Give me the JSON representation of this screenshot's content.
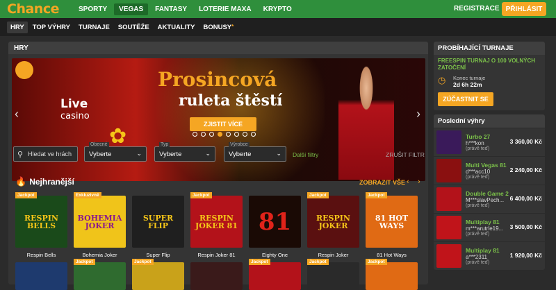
{
  "header": {
    "logo": "Chance",
    "nav": [
      "SPORTY",
      "VEGAS",
      "FANTASY",
      "LOTERIE MAXA",
      "KRYPTO"
    ],
    "active_nav": "VEGAS",
    "register": "REGISTRACE",
    "login": "PŘIHLÁSIT"
  },
  "subnav": {
    "items": [
      "HRY",
      "TOP VÝHRY",
      "TURNAJE",
      "SOUTĚŽE",
      "AKTUALITY",
      "BONUSY"
    ],
    "active": "HRY",
    "bonus_marker": "*"
  },
  "main": {
    "title": "HRY",
    "banner": {
      "live": "Live",
      "casino": "casino",
      "title_line1": "Prosincová",
      "title_line2": "ruleta štěstí",
      "cta": "ZJISTIT VÍCE",
      "slides": 8,
      "active_slide": 3
    },
    "filters": {
      "search_placeholder": "Hledat ve hrách",
      "selects": [
        {
          "label": "Obecné",
          "value": "Vyberte"
        },
        {
          "label": "Typ",
          "value": "Vyberte"
        },
        {
          "label": "Výrobce",
          "value": "Vyberte"
        }
      ],
      "more": "Další filtry",
      "reset": "ZRUŠIT FILTR"
    },
    "section": {
      "title": "Nejhranější",
      "show_all": "ZOBRAZIT VŠE"
    },
    "games": [
      {
        "name": "Respin Bells",
        "tag": "Jackpot",
        "label": "RESPIN BELLS",
        "bg": "#1a4a1a",
        "fg": "#f5c518"
      },
      {
        "name": "Bohemia Joker",
        "tag": "Exkluzivně",
        "label": "BOHEMIA JOKER",
        "bg": "#f0c41a",
        "fg": "#8b1a8b"
      },
      {
        "name": "Super Flip",
        "tag": "",
        "label": "SUPER FLIP",
        "bg": "#1f1f1f",
        "fg": "#f5c518"
      },
      {
        "name": "Respin Joker 81",
        "tag": "Jackpot",
        "label": "RESPIN JOKER 81",
        "bg": "#b3121a",
        "fg": "#f5c518"
      },
      {
        "name": "Eighty One",
        "tag": "",
        "label": "81",
        "bg": "#1a0a05",
        "fg": "#e0231a"
      },
      {
        "name": "Respin Joker",
        "tag": "Jackpot",
        "label": "RESPIN JOKER",
        "bg": "#5a1010",
        "fg": "#f5c518"
      },
      {
        "name": "81 Hot Ways",
        "tag": "Jackpot",
        "label": "81 HOT WAYS",
        "bg": "#e06a14",
        "fg": "#ffffff"
      }
    ],
    "games_row2": [
      {
        "tag": "",
        "bg": "#1e3a6e"
      },
      {
        "tag": "Jackpot",
        "bg": "#2f6b2f"
      },
      {
        "tag": "Jackpot",
        "bg": "#c9a21a"
      },
      {
        "tag": "",
        "bg": "#3a1a1a"
      },
      {
        "tag": "Jackpot",
        "bg": "#b3121a"
      },
      {
        "tag": "Jackpot",
        "bg": "#2a2a2a"
      },
      {
        "tag": "Jackpot",
        "bg": "#e06a14"
      }
    ]
  },
  "sidebar": {
    "tournaments": {
      "title": "PROBÍHAJÍCÍ TURNAJE",
      "name": "FREESPIN TURNAJ O 100 VOLNÝCH ZATOČENÍ",
      "end_label": "Konec turnaje",
      "end_value": "2d 6h 22m",
      "join": "ZÚČASTNIT SE"
    },
    "wins": {
      "title": "Poslední výhry",
      "items": [
        {
          "game": "Turbo 27",
          "user": "h***kon",
          "time": "(právě teď)",
          "amount": "3 360,00 Kč",
          "bg": "#3a1a5a"
        },
        {
          "game": "Multi Vegas 81",
          "user": "d***acc10",
          "time": "(právě teď)",
          "amount": "2 240,00 Kč",
          "bg": "#8a1010"
        },
        {
          "game": "Double Game 2",
          "user": "M***slavPech...",
          "time": "(právě teď)",
          "amount": "6 400,00 Kč",
          "bg": "#b3121a"
        },
        {
          "game": "Multiplay 81",
          "user": "m***arutrle19...",
          "time": "(právě teď)",
          "amount": "3 500,00 Kč",
          "bg": "#c0141a"
        },
        {
          "game": "Multiplay 81",
          "user": "a***2311",
          "time": "(právě teď)",
          "amount": "1 920,00 Kč",
          "bg": "#c0141a"
        }
      ]
    }
  }
}
